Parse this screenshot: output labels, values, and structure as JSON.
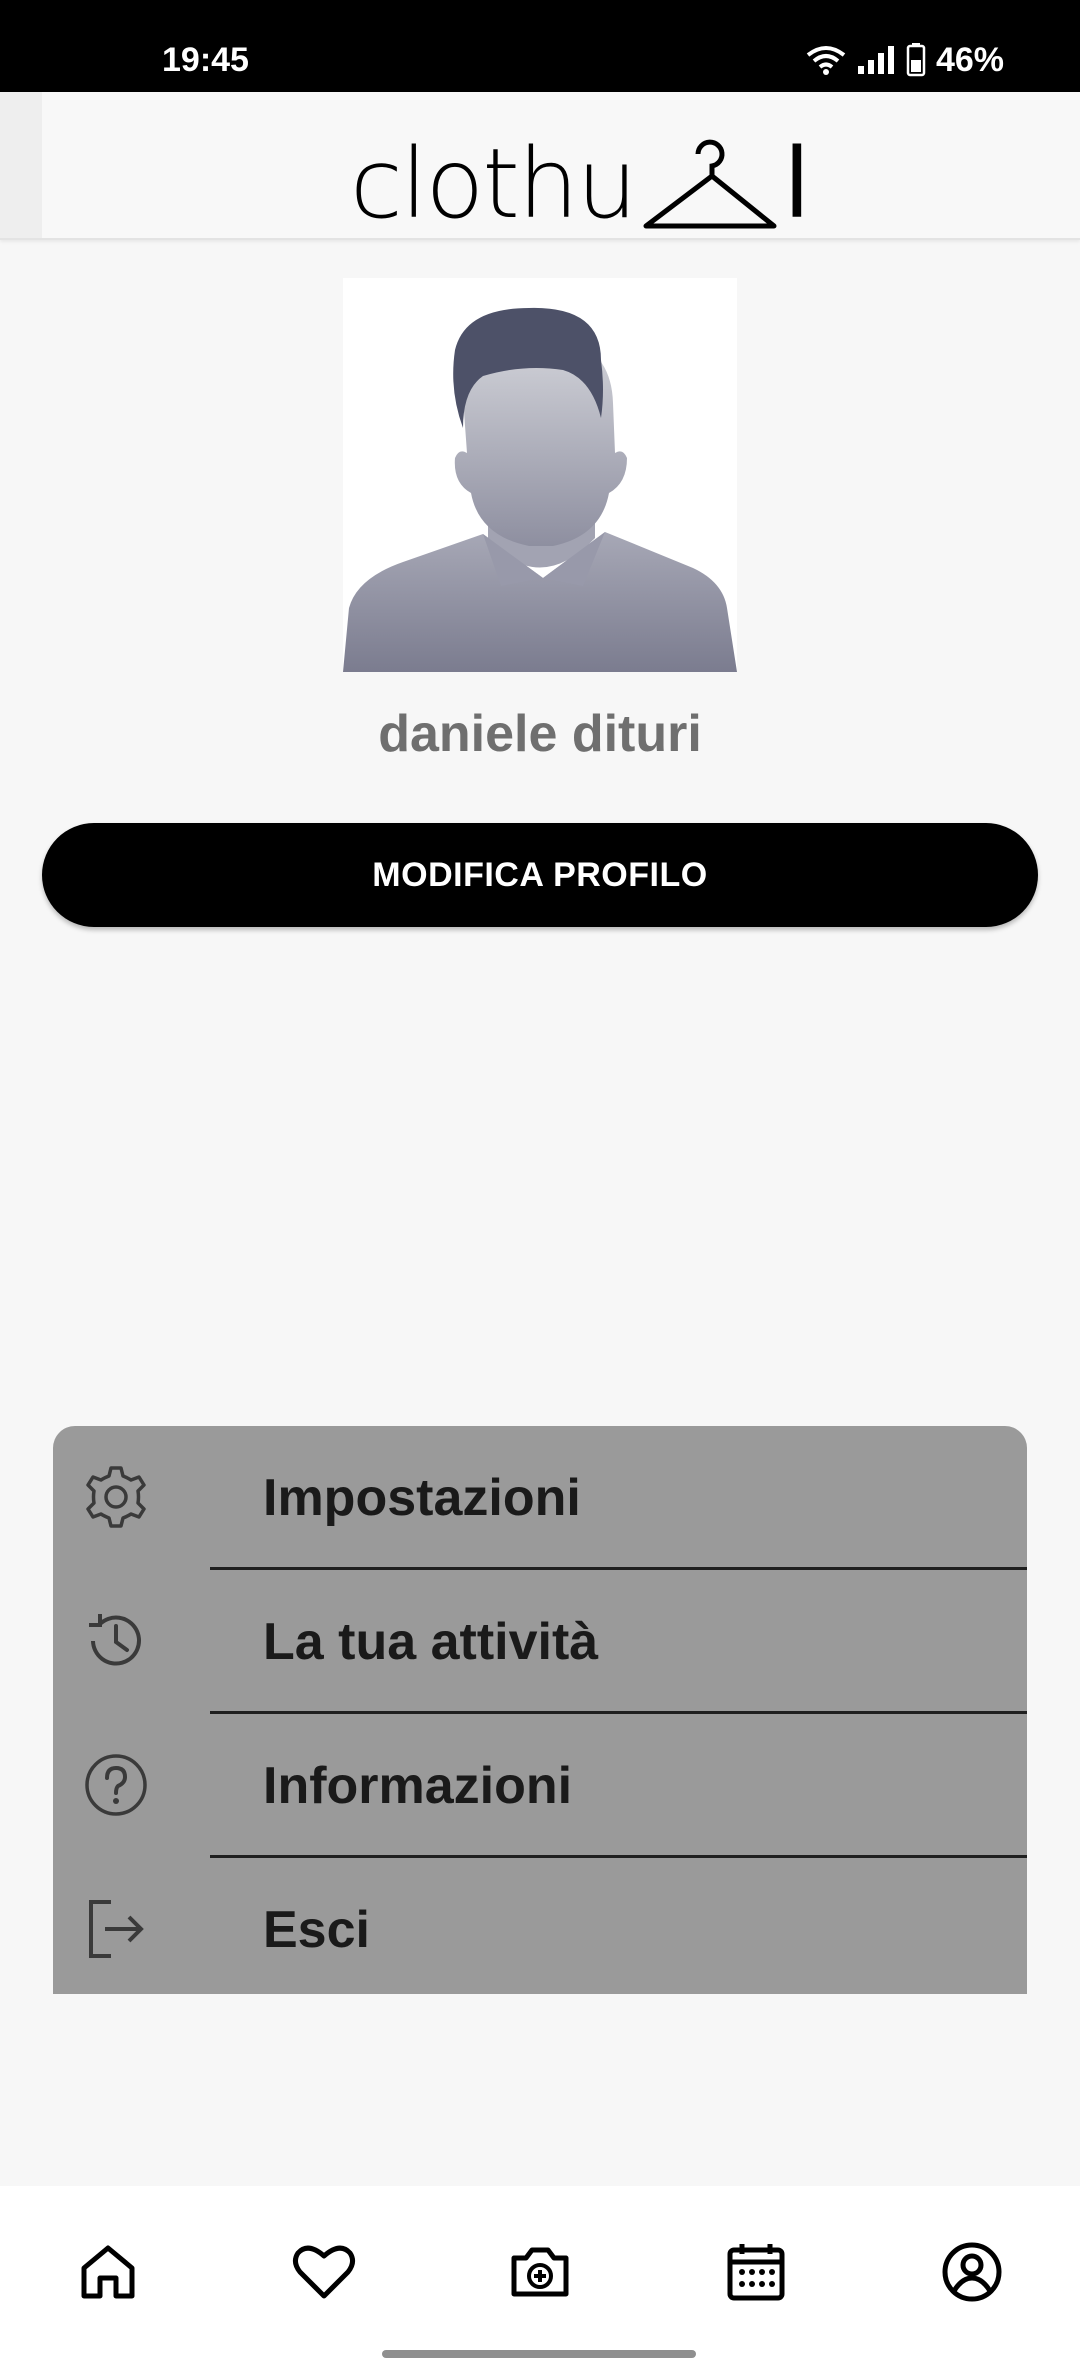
{
  "status_bar": {
    "time": "19:45",
    "battery": "46%"
  },
  "header": {
    "logo_prefix": "clothu",
    "logo_suffix": "l"
  },
  "profile": {
    "name": "daniele dituri",
    "edit_button_label": "MODIFICA PROFILO"
  },
  "menu": {
    "items": [
      {
        "label": "Impostazioni",
        "icon": "gear-icon"
      },
      {
        "label": "La tua attività",
        "icon": "history-icon"
      },
      {
        "label": "Informazioni",
        "icon": "help-circle-icon"
      },
      {
        "label": "Esci",
        "icon": "logout-icon"
      }
    ]
  },
  "bottom_nav": {
    "items": [
      {
        "icon": "home-icon"
      },
      {
        "icon": "heart-icon"
      },
      {
        "icon": "camera-plus-icon"
      },
      {
        "icon": "calendar-icon"
      },
      {
        "icon": "account-circle-icon"
      }
    ]
  },
  "colors": {
    "background": "#f7f7f7",
    "menu_background": "#9a9a9a",
    "button_background": "#000000",
    "username_text": "#6f6f6f"
  }
}
